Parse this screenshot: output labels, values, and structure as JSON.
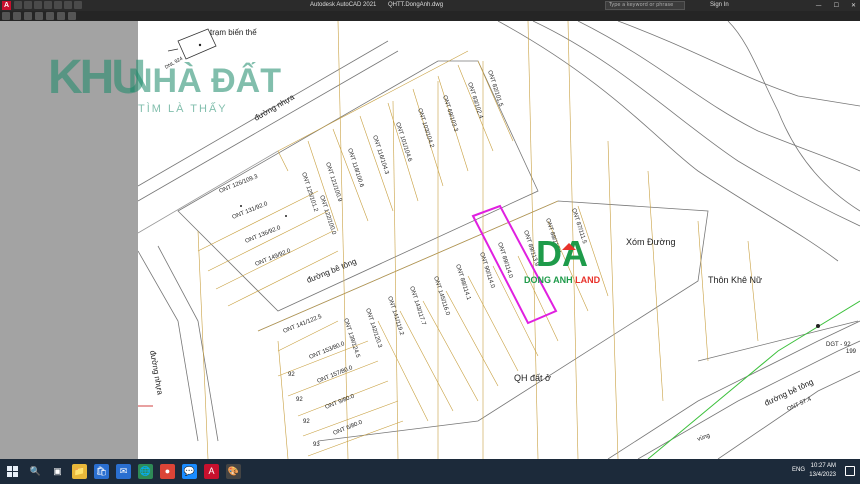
{
  "titlebar": {
    "logo_letter": "A",
    "app_title": "Autodesk AutoCAD 2021",
    "file_title": "QHTT.DongAnh.dwg",
    "search_placeholder": "Type a keyword or phrase",
    "sign_in": "Sign In",
    "window_controls": [
      "—",
      "☐",
      "✕"
    ]
  },
  "watermarks": {
    "khu": "KHU",
    "nha_dat": "NHÀ ĐẤT",
    "tagline": "TÌM LÀ THẤY",
    "da_letters": "DA",
    "da_name_left": "DONG ANH ",
    "da_name_right": "LAND"
  },
  "drawing": {
    "labels": {
      "tram_bien_the": "trạm biến thế",
      "duong_nhua_top": "đường nhựa",
      "duong_nhua_left": "đường nhựa",
      "duong_be_tong_center": "đường bê tông",
      "duong_be_tong_right": "đường bê tông",
      "xom_duong": "Xóm Đường",
      "thon_khe_nu": "Thôn Khê Nữ",
      "qh_dat_o": "QH đất ở",
      "dnl": "DNL 924",
      "dgt": "DGT - 92",
      "dgt_val": "199",
      "vung": "vùng"
    },
    "top_lots": [
      "ONT 82/101.5",
      "ONT 83/102.4",
      "ONT 69/103.3",
      "ONT 103/104.2",
      "ONT 101/104.6",
      "ONT 116/104.3",
      "ONT 118/100.6",
      "ONT 121/100.9",
      "ONT 125/101.2",
      "ONT 122/100.0"
    ],
    "left_lots": [
      "ONT 126/109.3",
      "ONT 131/92.0",
      "ONT 136/92.0",
      "ONT 149/92.0"
    ],
    "middle_lots": [
      "ONT 87/111.5",
      "ONT 88/113.1",
      "ONT 89/113.9",
      "ONT 89/114.0",
      "ONT 90/114.0",
      "ONT 88/114.1",
      "ONT 145/116.0",
      "ONT 143/117.7",
      "ONT 141/119.2",
      "ONT 142/120.3",
      "ONT 139/124.5"
    ],
    "bottom_lots": [
      "ONT 141/122.5",
      "ONT 153/80.0",
      "ONT 157/80.0",
      "ONT 9/80.0",
      "ONT 6/80.0"
    ],
    "small_labels": [
      "92",
      "92",
      "92",
      "93",
      "ONT 57.4"
    ],
    "highlight_lot": "ONT 89/114.0"
  },
  "taskbar": {
    "time": "10:27 AM",
    "date": "13/4/2023",
    "lang": "ENG",
    "app_icons": [
      "🔍",
      "▣",
      "📁",
      "🛍",
      "✉",
      "🌐",
      "●",
      "💬",
      "A",
      "🎨"
    ]
  },
  "colors": {
    "lot_line": "#c8a040",
    "road_line": "#777777",
    "highlight": "#e020e0",
    "green_line": "#3cc03c",
    "watermark": "#1b8a6a"
  }
}
